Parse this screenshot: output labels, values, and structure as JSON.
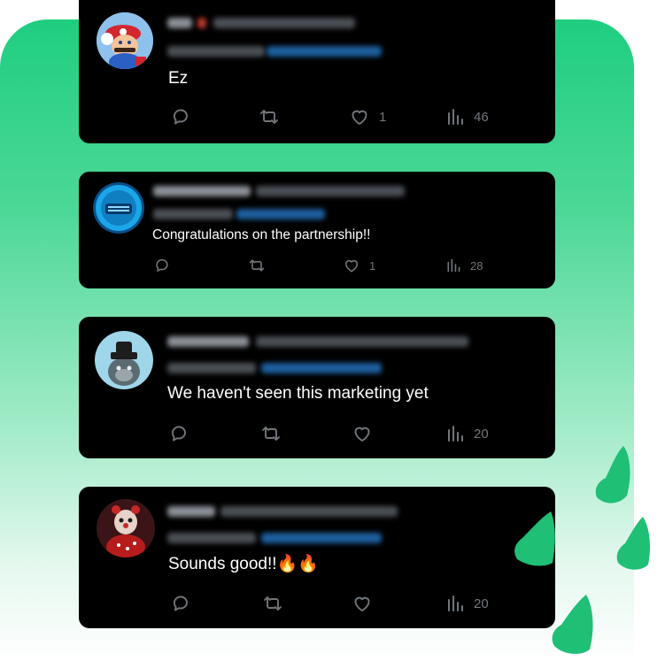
{
  "replies": [
    {
      "text": "Ez",
      "likes": "1",
      "views": "46",
      "avatar": "mario-avatar"
    },
    {
      "text": "Congratulations on the partnership!!",
      "likes": "1",
      "views": "28",
      "avatar": "arena-avatar"
    },
    {
      "text": "We haven't seen this marketing yet",
      "likes": "",
      "views": "20",
      "avatar": "ape-avatar"
    },
    {
      "text": "Sounds good!!🔥🔥",
      "likes": "",
      "views": "20",
      "avatar": "clown-avatar"
    }
  ],
  "colors": {
    "accent_green": "#1fce80",
    "card_bg": "#000000",
    "icon_gray": "#71767b",
    "text_white": "#ffffff"
  }
}
